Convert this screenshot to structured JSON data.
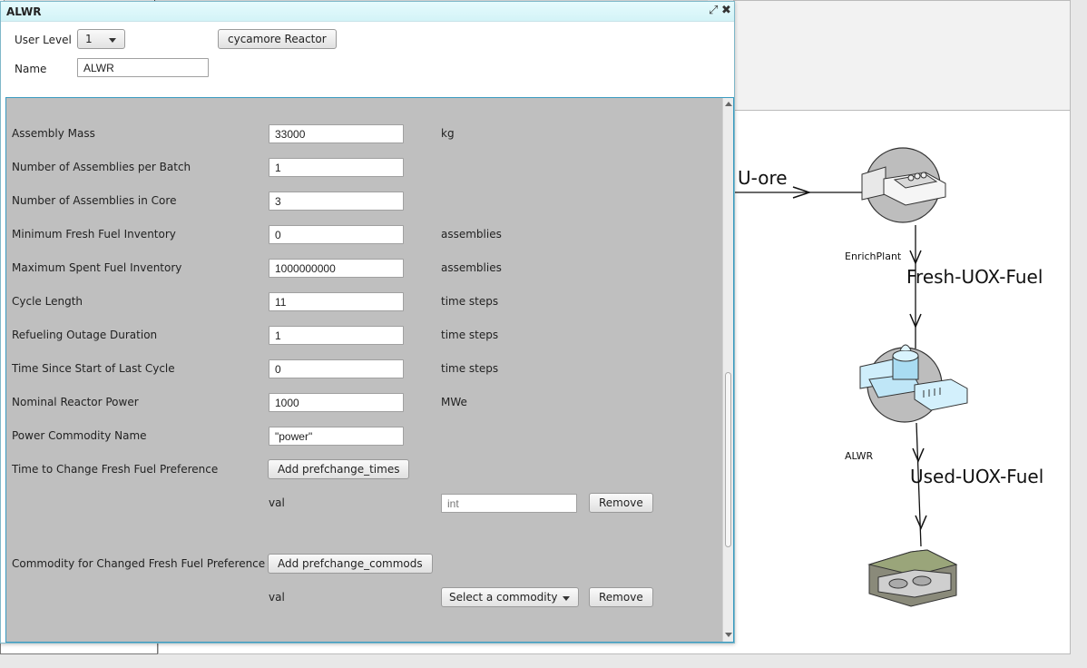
{
  "window": {
    "title": "ALWR",
    "maximize_icon": "expand-icon",
    "close_icon": "close-icon"
  },
  "header": {
    "user_level_label": "User Level",
    "user_level_value": "1",
    "archetype_button": "cycamore Reactor",
    "name_label": "Name",
    "name_value": "ALWR"
  },
  "params": [
    {
      "label": "Assembly Mass",
      "value": "33000",
      "unit": "kg"
    },
    {
      "label": "Number of Assemblies per Batch",
      "value": "1",
      "unit": ""
    },
    {
      "label": "Number of Assemblies in Core",
      "value": "3",
      "unit": ""
    },
    {
      "label": "Minimum Fresh Fuel Inventory",
      "value": "0",
      "unit": "assemblies"
    },
    {
      "label": "Maximum Spent Fuel Inventory",
      "value": "1000000000",
      "unit": "assemblies"
    },
    {
      "label": "Cycle Length",
      "value": "11",
      "unit": "time steps"
    },
    {
      "label": "Refueling Outage Duration",
      "value": "1",
      "unit": "time steps"
    },
    {
      "label": "Time Since Start of Last Cycle",
      "value": "0",
      "unit": "time steps"
    },
    {
      "label": "Nominal Reactor Power",
      "value": "1000",
      "unit": "MWe"
    },
    {
      "label": "Power Commodity Name",
      "value": "\"power\"",
      "unit": ""
    }
  ],
  "prefchange_times": {
    "label": "Time to Change Fresh Fuel Preference",
    "add_button": "Add prefchange_times",
    "val_label": "val",
    "val_placeholder": "int",
    "remove_button": "Remove"
  },
  "prefchange_commods": {
    "label": "Commodity for Changed Fresh Fuel Preference",
    "add_button": "Add prefchange_commods",
    "val_label": "val",
    "select_value": "Select a commodity",
    "remove_button": "Remove"
  },
  "graph": {
    "nodes": [
      {
        "label": "EnrichPlant",
        "icon": "enrichment-plant-icon"
      },
      {
        "label": "ALWR",
        "icon": "reactor-icon"
      },
      {
        "label": "",
        "icon": "repository-icon"
      }
    ],
    "edges": [
      "U-ore",
      "Fresh-UOX-Fuel",
      "Used-UOX-Fuel"
    ]
  },
  "colors": {
    "titlebar": "#d9f6f9",
    "panel_bg": "#bfbfbf",
    "panel_border": "#3a9ac0"
  }
}
